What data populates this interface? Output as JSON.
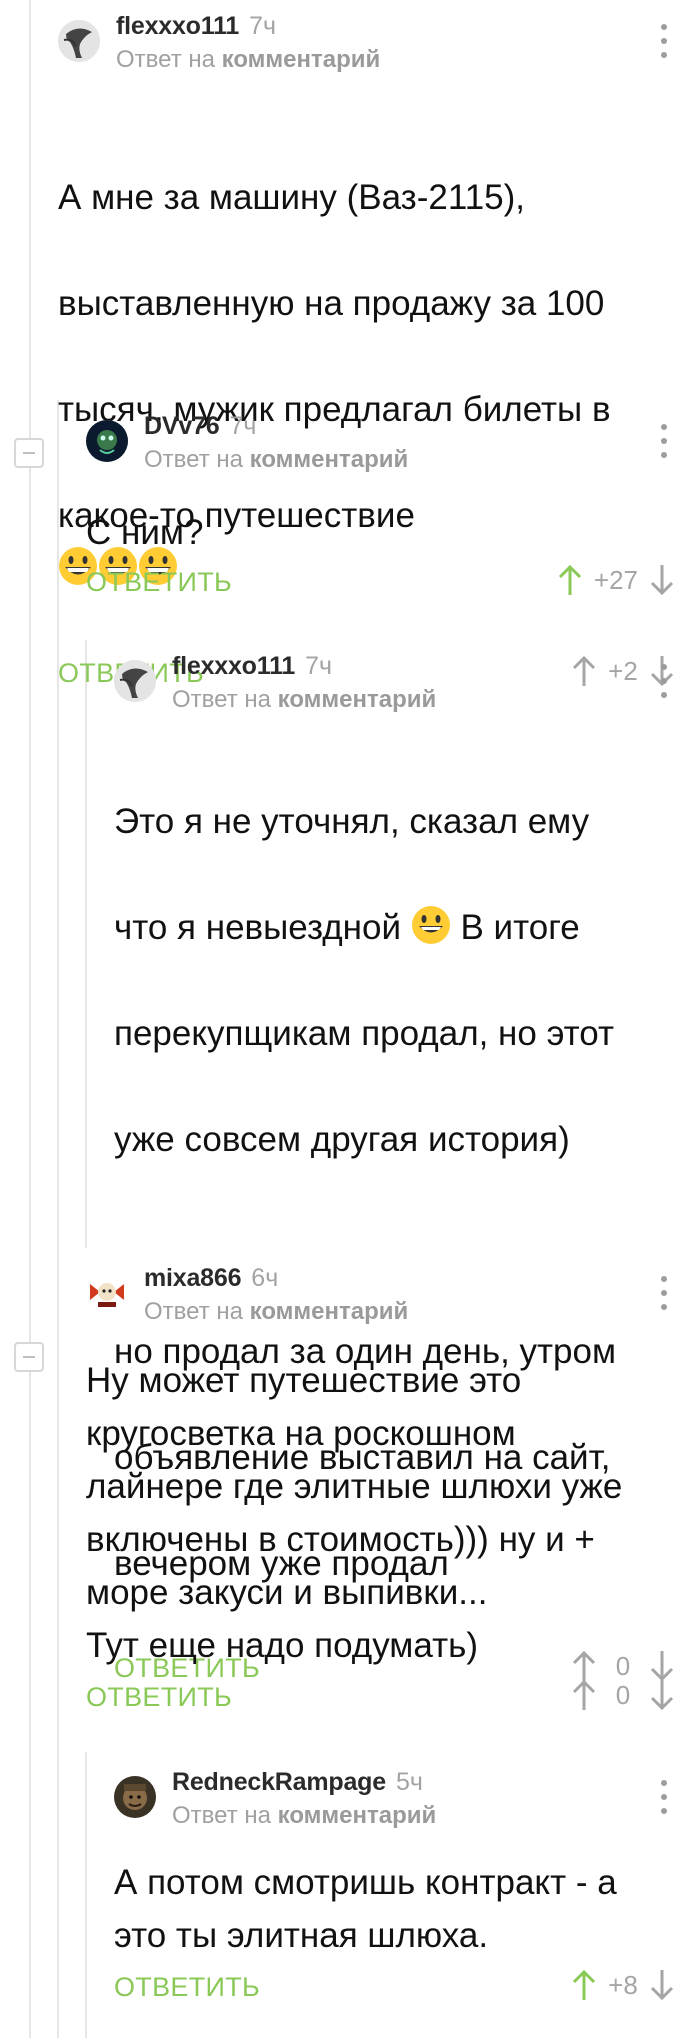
{
  "ui": {
    "reply_label": "ОТВЕТИТЬ",
    "reply_to_prefix": "Ответ на",
    "reply_to_target": "комментарий"
  },
  "colors": {
    "accent_green": "#8ac858",
    "upvoted_arrow": "#8ac858",
    "muted_gray": "#a3a3a3"
  },
  "comments": [
    {
      "username": "flexxxo111",
      "time": "7ч",
      "text_lines": [
        "А мне за машину (Ваз-2115),",
        "выставленную на продажу за 100",
        "тысяч, мужик предлагал билеты в",
        "какое-то путешествие"
      ],
      "rating": "+2",
      "upvoted": false,
      "emoji_count": 3
    },
    {
      "username": "DVv76",
      "time": "7ч",
      "text": "С ним?",
      "rating": "+27",
      "upvoted": true
    },
    {
      "username": "flexxxo111",
      "time": "7ч",
      "text_lines_a": [
        "Это я не уточнял, сказал ему"
      ],
      "line2_start": "что я невыездной",
      "line2_end": " В итоге",
      "text_lines_b": [
        "перекупщикам продал, но этот",
        "уже совсем другая история)",
        "",
        "но продал за один день, утром",
        "объявление выставил на сайт,",
        "вечером уже продал"
      ],
      "rating": "0",
      "upvoted": false
    },
    {
      "username": "mixa866",
      "time": "6ч",
      "text": "Ну может путешествие это\nкругосветка на роскошном\nлайнере где элитные шлюхи уже\nвключены в стоимость))) ну и +\nморе закуси и выпивки...\nТут еще надо подумать)",
      "rating": "0",
      "upvoted": false
    },
    {
      "username": "RedneckRampage",
      "time": "5ч",
      "text": "А потом смотришь контракт - а\nэто ты элитная шлюха.",
      "rating": "+8",
      "upvoted": true
    }
  ]
}
